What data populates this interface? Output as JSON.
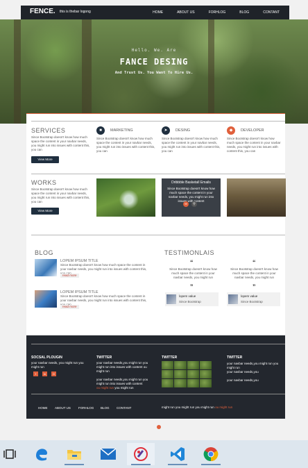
{
  "navbar": {
    "brand": "FENCE.",
    "tagline": "this is thebar logong",
    "links": [
      "HOME",
      "ABOUT US",
      "FORHLOG",
      "BLOG",
      "CONTANT"
    ]
  },
  "hero": {
    "hello": "Hello. We. Are",
    "title": "FANCE DESING",
    "subtitle": "And Trust Us. You Want To Hire Us."
  },
  "services": {
    "title": "SERVICES",
    "text": "Since Bootstrap doesn't know how much space the content in your navbar needs, you might run into issues with content this, you can",
    "button": "View More",
    "items": [
      {
        "label": "MARKETING",
        "icon": "bag-icon",
        "text": "Since Bootstrap doesn't know how much space the content in your navbar needs, you might run into issues with content this, you can"
      },
      {
        "label": "DESING",
        "icon": "send-icon",
        "text": "Since Bootstrap doesn't know how much space the content in your navbar needs, you might run into issues with content this, you can"
      },
      {
        "label": "DEVELOPER",
        "icon": "code-icon",
        "text": "Since Bootstrap doesn't know how much space the content in your navbar needs, you might run into issues with content this, you can"
      }
    ]
  },
  "works": {
    "title": "WORKS",
    "text": "Since Bootstrap doesn't know how much space the content in your navbar needs, you might run into issues with content this, you can",
    "button": "View More",
    "overlay_title": "Dribbble Basketall Emails",
    "overlay_text": "Since Bootstrap doesn't know how much space the content in your navbar needs, you might run into issues with content"
  },
  "blog": {
    "title": "BLOG",
    "posts": [
      {
        "title": "LOPEM IPSUM TITLE",
        "text": "Since Bootstrap doesn't know how much space the content in your navbar needs, you might run into issues with content this, you can",
        "more": "read more"
      },
      {
        "title": "LOPEM IPSUM TITLE",
        "text": "Since Bootstrap doesn't know how much space the content in your navbar needs, you might run into issues with content this, you can",
        "more": "read more"
      }
    ]
  },
  "testimonials": {
    "title": "TESTIMONLAIS",
    "items": [
      {
        "quote": "Since Bootstrap doesn't know how much space the content in your navbar needs, you might run",
        "name": "lopem value",
        "role": "Since Bootstrap"
      },
      {
        "quote": "Since Bootstrap doesn't know how much space the content in your navbar needs, you might run",
        "name": "lopem value",
        "role": "Since Bootstrap"
      }
    ]
  },
  "footer": {
    "social_title": "SOCSAL PLOUGIN",
    "social_text": "your navbar needs, you might run you might run",
    "social_icons": [
      "f",
      "in",
      "G"
    ],
    "twitter1_title": "TWITTER",
    "twitter1_text1": "your navbar needs,you might run you might run into issues with content ou might run",
    "twitter1_text2": "your navbar needs,you might run you might run into issues with content",
    "twitter1_red": "ou might run",
    "twitter1_tail": "you might run",
    "twitter2_title": "TWITTER",
    "twitter3_title": "TWITTER",
    "twitter3_lines": [
      "your navbar needs,you might run you might run",
      "your navbar needs,you",
      "your navbar needs,you"
    ],
    "links": [
      "HOME",
      "ABOUT US",
      "FORHLOG",
      "BLOG",
      "CONTANT"
    ],
    "bottom_text": "might run you might run you might run",
    "bottom_red": "ou might run"
  },
  "colors": {
    "accent": "#e0603c",
    "dark": "#23272e",
    "navy": "#1f2f3f"
  }
}
